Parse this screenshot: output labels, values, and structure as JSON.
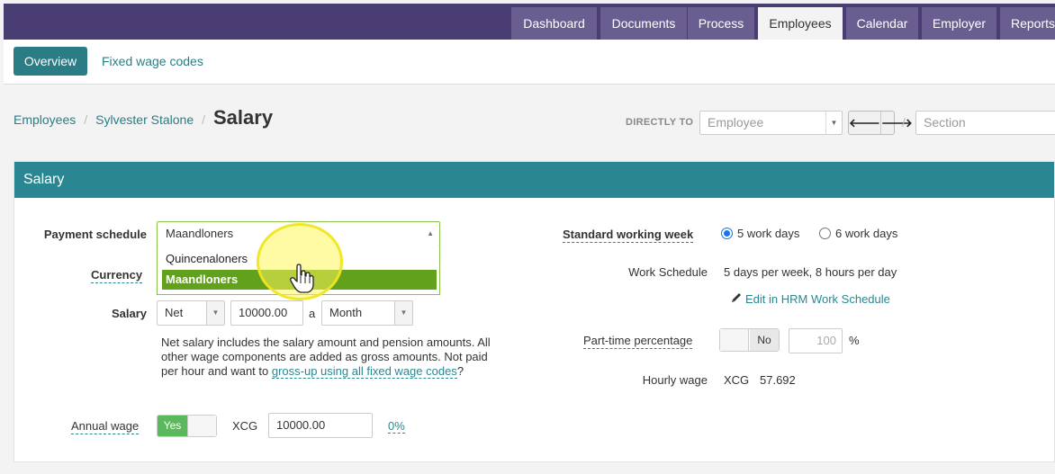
{
  "topnav": {
    "tabs": [
      {
        "label": "Dashboard"
      },
      {
        "label": "Documents"
      },
      {
        "label": "Process"
      },
      {
        "label": "Employees"
      },
      {
        "label": "Calendar"
      },
      {
        "label": "Employer"
      },
      {
        "label": "Reports"
      }
    ],
    "active": "Employees"
  },
  "subnav": {
    "overview_label": "Overview",
    "fixed_wage_label": "Fixed wage codes"
  },
  "breadcrumb": {
    "employees": "Employees",
    "person": "Sylvester Stalone",
    "sep": "/",
    "current": "Salary"
  },
  "jump": {
    "label": "DIRECTLY TO",
    "employee_placeholder": "Employee",
    "section_placeholder": "Section",
    "sep": "/"
  },
  "panel": {
    "title": "Salary",
    "payment_schedule": {
      "label": "Payment schedule",
      "value": "Maandloners",
      "options": [
        "Quincenaloners",
        "Maandloners"
      ],
      "selected": "Maandloners"
    },
    "currency": {
      "label": "Currency"
    },
    "salary": {
      "label": "Salary",
      "type": "Net",
      "amount": "10000.00",
      "per": "a",
      "period": "Month"
    },
    "help": {
      "text1": "Net salary includes the salary amount and pension amounts. All other wage components are added as gross amounts. Not paid per hour and want to ",
      "link": "gross-up using all fixed wage codes",
      "text2": "?"
    },
    "annual_wage": {
      "label": "Annual wage",
      "toggle": "Yes",
      "currency": "XCG",
      "value": "10000.00",
      "percent": "0%"
    },
    "standard_week": {
      "label": "Standard working week",
      "opt1": "5 work days",
      "opt2": "6 work days",
      "selected": "5 work days"
    },
    "work_schedule": {
      "label": "Work Schedule",
      "value": "5 days per week, 8 hours per day",
      "edit_link": "Edit in HRM Work Schedule"
    },
    "part_time": {
      "label": "Part-time percentage",
      "toggle": "No",
      "placeholder": "100",
      "unit": "%"
    },
    "hourly_wage": {
      "label": "Hourly wage",
      "currency": "XCG",
      "value": "57.692"
    }
  },
  "colors": {
    "topnav_bg": "#4a3d73",
    "tab_bg": "#6a5e90",
    "accent": "#2a8792",
    "selected_option": "#62a11c",
    "toggle_on": "#5cb85c"
  },
  "icons": [
    "pencil-icon",
    "arrow-left-icon",
    "arrow-right-icon",
    "hand-pointer-icon",
    "chevron-down-icon"
  ]
}
